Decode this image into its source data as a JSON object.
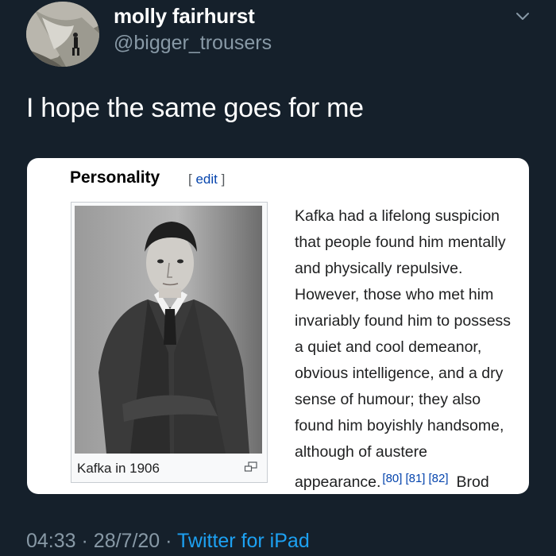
{
  "user": {
    "display_name": "molly fairhurst",
    "handle": "@bigger_trousers"
  },
  "tweet": {
    "text": "I hope the same goes for me"
  },
  "wiki_card": {
    "section_title": "Personality",
    "edit": {
      "open": "[",
      "label": "edit",
      "close": "]"
    },
    "image_caption": "Kafka in 1906",
    "body_lines": [
      "Kafka had a lifelong suspicion",
      "that people found him mentally",
      "and physically repulsive.",
      "However, those who met him",
      "invariably found him to possess",
      "a quiet and cool demeanor,",
      "obvious intelligence, and a dry",
      "sense of humour; they also",
      "found him boyishly handsome,",
      "although of austere"
    ],
    "last_line_text": "appearance.",
    "references": [
      "[80]",
      "[81]",
      "[82]"
    ],
    "trailing_text": "Brod"
  },
  "meta": {
    "time": "04:33",
    "separator": "·",
    "date": "28/7/20",
    "source": "Twitter for iPad"
  },
  "icons": {
    "more": "chevron-down-icon",
    "enlarge": "enlarge-icon"
  },
  "colors": {
    "background": "#15202b",
    "secondary_text": "#8899a6",
    "link_blue": "#1da1f2",
    "wiki_link": "#0645ad"
  }
}
